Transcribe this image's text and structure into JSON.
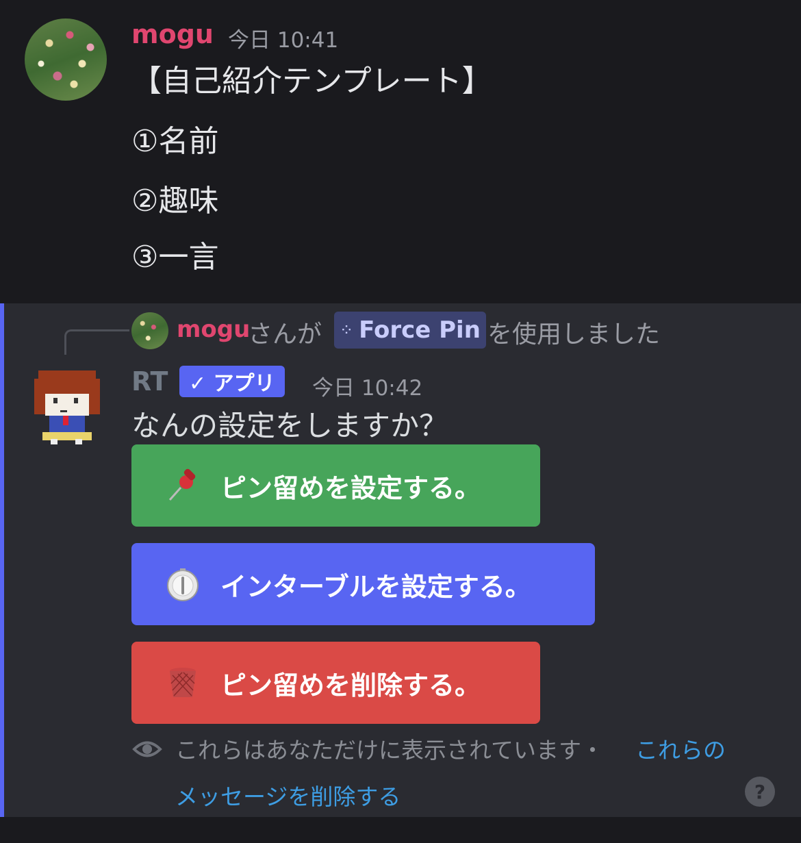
{
  "message1": {
    "username": "mogu",
    "timestamp": "今日 10:41",
    "lines": [
      "【自己紹介テンプレート】",
      "①名前",
      "②趣味",
      "③一言"
    ],
    "avatar_icon": "flower-field-avatar"
  },
  "reply": {
    "username": "mogu",
    "text_before": "さんが",
    "command": "Force Pin",
    "command_icon": "app-command-icon",
    "text_after": "を使用しました"
  },
  "message2": {
    "username": "RT",
    "badge": "✓ アプリ",
    "timestamp": "今日 10:42",
    "text": "なんの設定をしますか？",
    "avatar_icon": "pixel-character-avatar"
  },
  "buttons": [
    {
      "label": "ピン留めを設定する。",
      "icon": "pushpin-icon",
      "color": "#47a55a"
    },
    {
      "label": "インターブルを設定する。",
      "icon": "timer-icon",
      "color": "#5865f2"
    },
    {
      "label": "ピン留めを削除する。",
      "icon": "wastebasket-icon",
      "color": "#da4a46"
    }
  ],
  "ephemeral": {
    "text": "これらはあなただけに表示されています・",
    "link_part1": "これらの",
    "link_part2": "メッセージを削除する",
    "help": "?"
  },
  "colors": {
    "accent": "#5865f2",
    "username": "#e0466f",
    "link": "#3e9de3"
  }
}
